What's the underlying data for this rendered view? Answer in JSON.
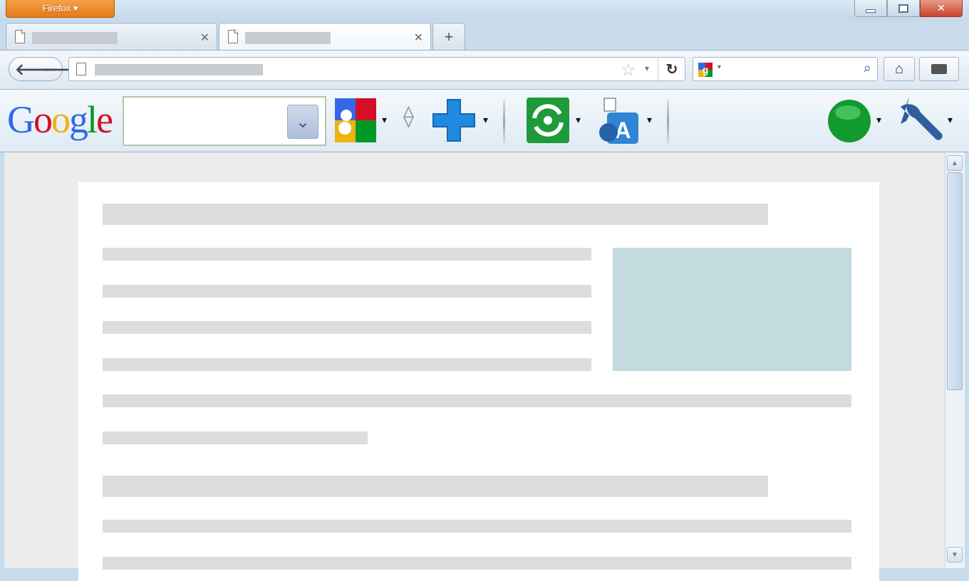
{
  "window": {
    "app_button_label": "Firefox ▾",
    "controls": {
      "minimize": "",
      "maximize": "",
      "close": "✕"
    }
  },
  "tabs": [
    {
      "title": "",
      "close": "✕",
      "active": false
    },
    {
      "title": "",
      "close": "✕",
      "active": true
    }
  ],
  "new_tab_label": "+",
  "navbar": {
    "back": "🡐",
    "forward": "🡒",
    "url": "",
    "star": "☆",
    "star_drop": "▾",
    "reload": "↻",
    "search_engine_drop": "▾",
    "search_value": "",
    "search_go": "⌕",
    "home": "⌂"
  },
  "google_toolbar": {
    "logo": {
      "G": "G",
      "o1": "o",
      "o2": "o",
      "g": "g",
      "l": "l",
      "e": "e"
    },
    "search_value": "",
    "search_drop": "⌄",
    "drop": "▾"
  },
  "colors": {
    "firefox_orange": "#e57a16",
    "close_red": "#c8432b",
    "google_blue": "#3369e8",
    "google_red": "#d50f25",
    "google_yellow": "#eeb211",
    "google_green": "#009925",
    "image_placeholder": "#c3dadf"
  },
  "icons": [
    "page-icon",
    "star-icon",
    "reload-icon",
    "google-search-engine-icon",
    "home-icon",
    "bookmarks-icon",
    "google-apps-icon",
    "plus-icon",
    "sharing-icon",
    "translate-icon",
    "status-dot-icon",
    "wrench-icon"
  ],
  "scrollbar": {
    "up": "▲",
    "down": "▼"
  }
}
